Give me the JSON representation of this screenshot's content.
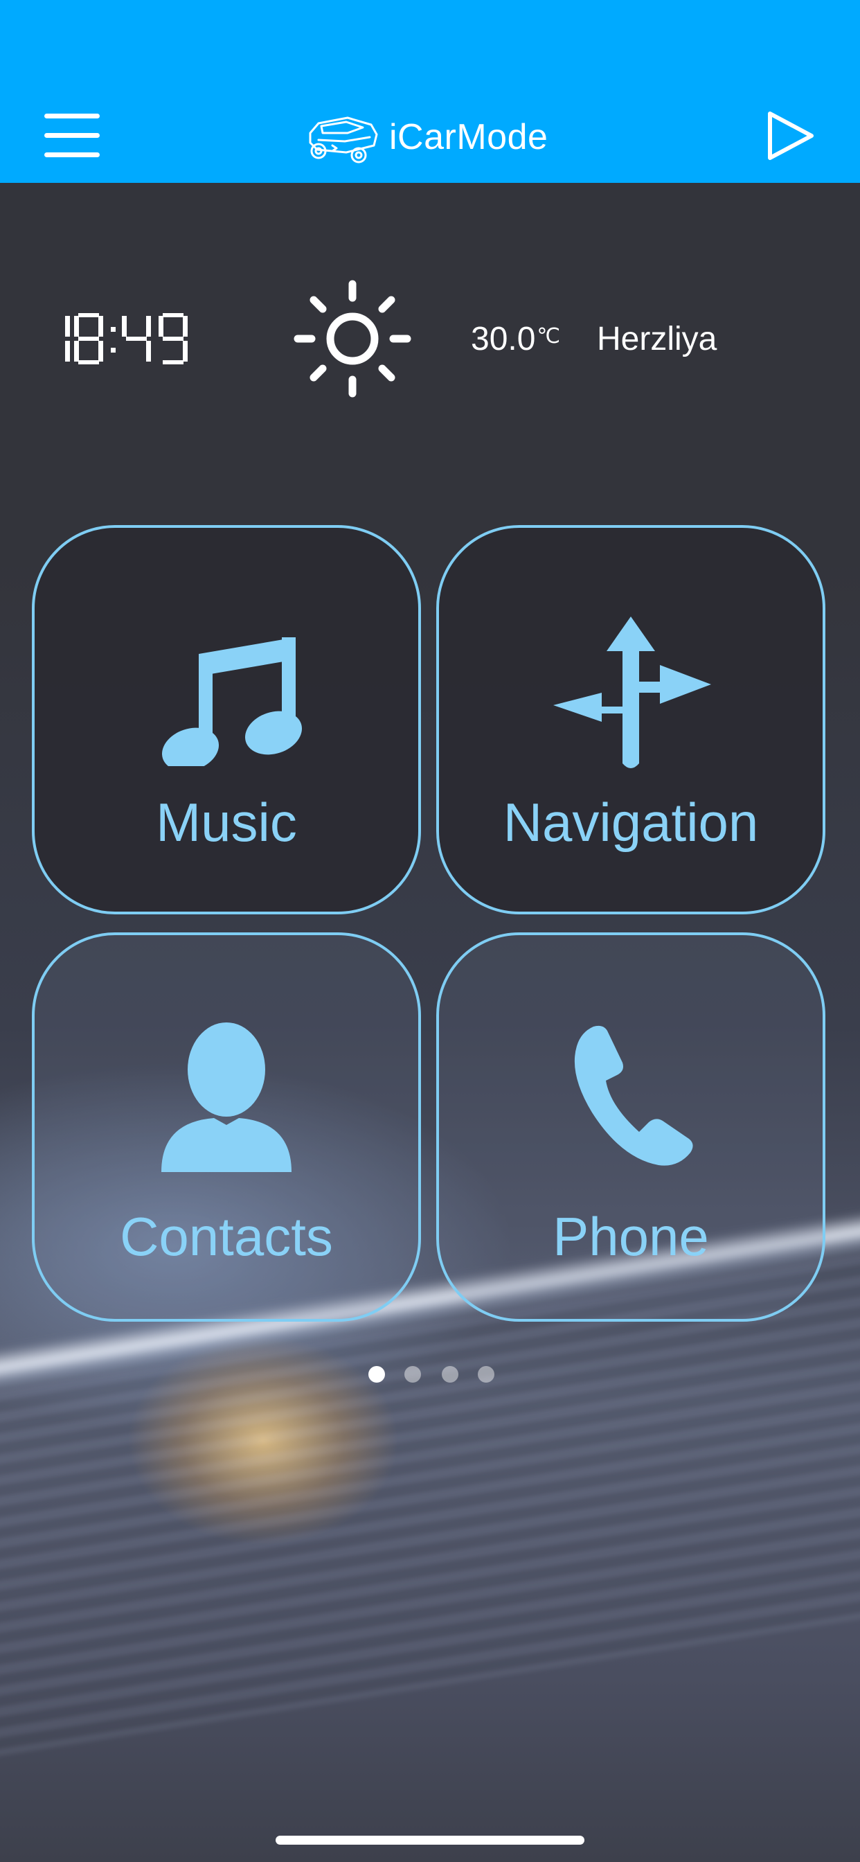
{
  "header": {
    "title": "iCarMode",
    "menu_icon": "hamburger-menu-icon",
    "logo_icon": "car-logo-icon",
    "action_icon": "play-icon",
    "background_color": "#00aaff"
  },
  "status": {
    "time": "18:49",
    "weather_icon": "sun-icon",
    "temperature": "30.0",
    "temperature_unit": "℃",
    "city": "Herzliya"
  },
  "tiles": [
    {
      "label": "Music",
      "icon": "music-note-icon"
    },
    {
      "label": "Navigation",
      "icon": "direction-arrows-icon"
    },
    {
      "label": "Contacts",
      "icon": "person-icon"
    },
    {
      "label": "Phone",
      "icon": "phone-handset-icon"
    }
  ],
  "pager": {
    "count": 4,
    "active_index": 0
  },
  "colors": {
    "accent": "#8ad2f7",
    "tile_border": "#7fcdf3",
    "header": "#00aaff"
  }
}
